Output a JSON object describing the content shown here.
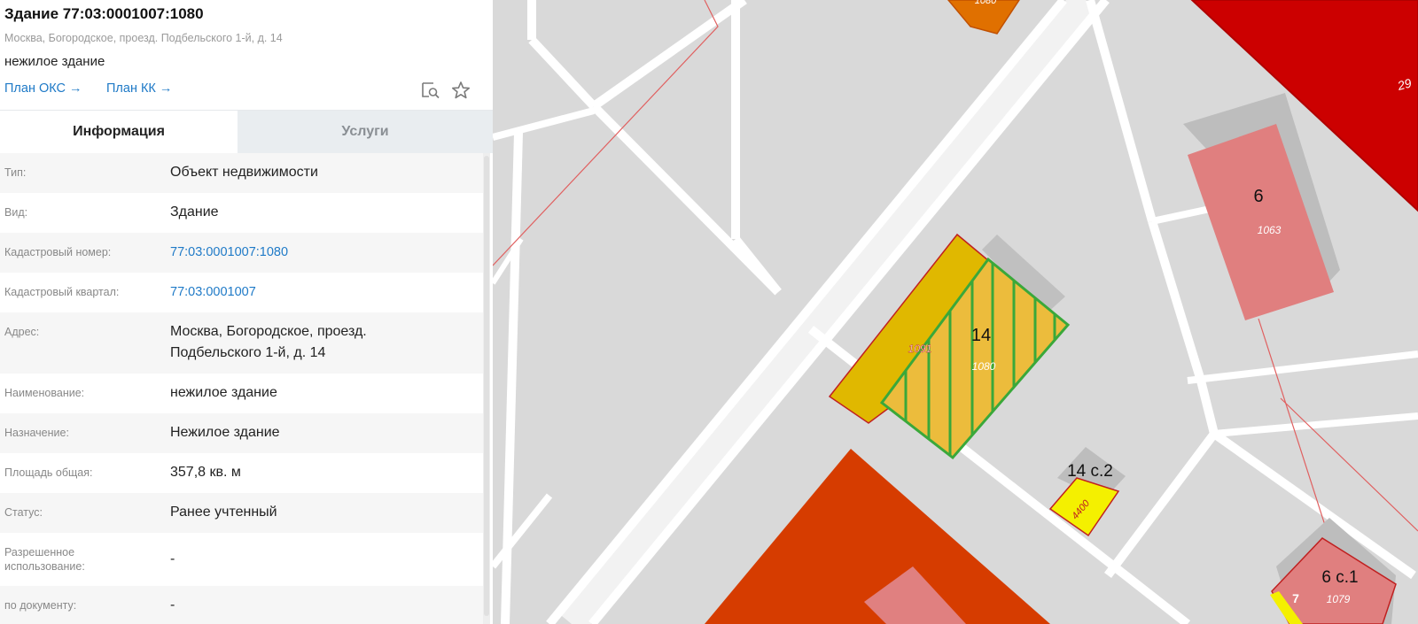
{
  "header": {
    "title": "Здание 77:03:0001007:1080",
    "address": "Москва, Богородское, проезд. Подбельского 1-й, д. 14",
    "object_type": "нежилое здание",
    "links": [
      {
        "label": "План ОКС",
        "arrow": "→"
      },
      {
        "label": "План КК",
        "arrow": "→"
      }
    ],
    "icons": [
      "map-search-icon",
      "star-icon"
    ]
  },
  "tabs": [
    {
      "label": "Информация",
      "active": true
    },
    {
      "label": "Услуги",
      "active": false
    }
  ],
  "info_rows": [
    {
      "label": "Тип:",
      "value": "Объект недвижимости"
    },
    {
      "label": "Вид:",
      "value": "Здание"
    },
    {
      "label": "Кадастровый номер:",
      "value": "77:03:0001007:1080",
      "link": true
    },
    {
      "label": "Кадастровый квартал:",
      "value": "77:03:0001007",
      "link": true
    },
    {
      "label": "Адрес:",
      "value_lines": [
        "Москва, Богородское, проезд.",
        "Подбельского 1-й, д. 14"
      ]
    },
    {
      "label": "Наименование:",
      "value": "нежилое здание"
    },
    {
      "label": "Назначение:",
      "value": "Нежилое здание"
    },
    {
      "label": "Площадь общая:",
      "value": "357,8 кв. м"
    },
    {
      "label": "Статус:",
      "value": "Ранее учтенный"
    },
    {
      "label_lines": [
        "Разрешенное",
        "использование:"
      ],
      "value": "-"
    },
    {
      "label": "по документу:",
      "value": "-"
    }
  ],
  "map": {
    "labels": {
      "house_14": "14",
      "house_14_c2": "14 с.2",
      "house_6": "6",
      "house_6_c1": "6 с.1",
      "edge_29": "29",
      "num_7": "7",
      "parcel_1063": "1063",
      "parcel_1080": "1080",
      "parcel_1091": "1091",
      "parcel_4400": "4400",
      "parcel_1079": "1079",
      "parcel_top": "1080"
    },
    "colors": {
      "background": "#d9d9d9",
      "road": "#ffffff",
      "red_area": "#cc0000",
      "orange_area": "#d63c00",
      "pink_building": "#e08080",
      "yellow_building": "#e0b800",
      "selected_hatch": "#3aa83a",
      "boundary_line": "#e06060"
    }
  }
}
